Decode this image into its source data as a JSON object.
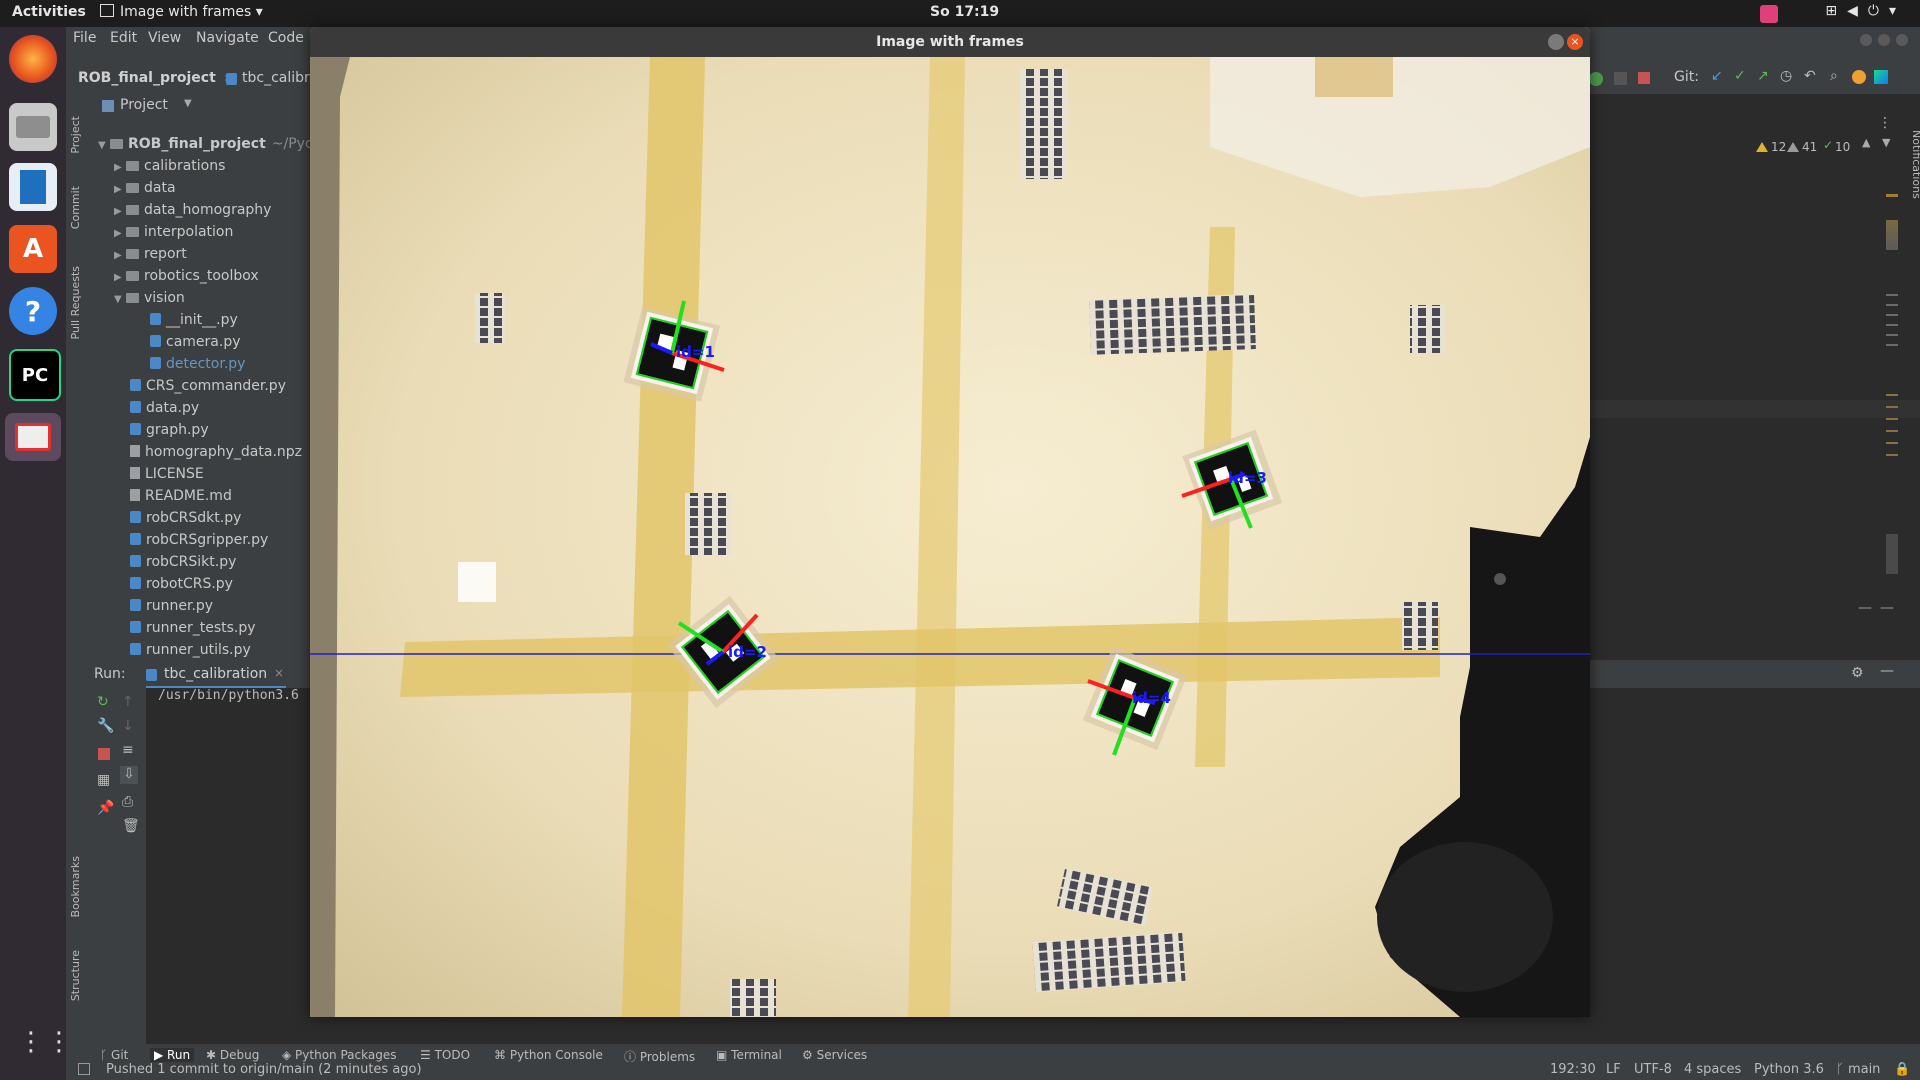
{
  "topbar": {
    "activities": "Activities",
    "window_title": "Image with frames",
    "window_menu_arrow": "▾",
    "clock": "So 17:19"
  },
  "ide": {
    "menu": [
      "File",
      "Edit",
      "View",
      "Navigate",
      "Code"
    ],
    "breadcrumb": {
      "project": "ROB_final_project",
      "file": "tbc_calibr"
    },
    "git_label": "Git:",
    "inspections": {
      "warn1": "12",
      "warn2": "41",
      "ok": "10"
    },
    "left_tabs": [
      "Project",
      "Commit",
      "Pull Requests",
      "Bookmarks",
      "Structure"
    ],
    "project_header": "Project",
    "tree": [
      {
        "label": "ROB_final_project",
        "suffix": "~/Pyc",
        "type": "root"
      },
      {
        "label": "calibrations",
        "type": "folder"
      },
      {
        "label": "data",
        "type": "folder"
      },
      {
        "label": "data_homography",
        "type": "folder"
      },
      {
        "label": "interpolation",
        "type": "folder"
      },
      {
        "label": "report",
        "type": "folder"
      },
      {
        "label": "robotics_toolbox",
        "type": "folder"
      },
      {
        "label": "vision",
        "type": "folder-open"
      },
      {
        "label": "__init__.py",
        "type": "py-nested"
      },
      {
        "label": "camera.py",
        "type": "py-nested"
      },
      {
        "label": "detector.py",
        "type": "py-nested-active"
      },
      {
        "label": "CRS_commander.py",
        "type": "py"
      },
      {
        "label": "data.py",
        "type": "py"
      },
      {
        "label": "graph.py",
        "type": "py"
      },
      {
        "label": "homography_data.npz",
        "type": "file"
      },
      {
        "label": "LICENSE",
        "type": "file"
      },
      {
        "label": "README.md",
        "type": "md"
      },
      {
        "label": "robCRSdkt.py",
        "type": "py"
      },
      {
        "label": "robCRSgripper.py",
        "type": "py"
      },
      {
        "label": "robCRSikt.py",
        "type": "py"
      },
      {
        "label": "robotCRS.py",
        "type": "py"
      },
      {
        "label": "runner.py",
        "type": "py"
      },
      {
        "label": "runner_tests.py",
        "type": "py"
      },
      {
        "label": "runner_utils.py",
        "type": "py"
      }
    ],
    "run": {
      "label": "Run:",
      "tab": "tbc_calibration",
      "output": "/usr/bin/python3.6"
    },
    "bottom_tabs": [
      "Git",
      "Run",
      "Debug",
      "Python Packages",
      "TODO",
      "Python Console",
      "Problems",
      "Terminal",
      "Services"
    ],
    "status": {
      "message": "Pushed 1 commit to origin/main (2 minutes ago)",
      "position": "192:30",
      "line_sep": "LF",
      "encoding": "UTF-8",
      "indent": "4 spaces",
      "interpreter": "Python 3.6",
      "branch": "main"
    },
    "notifications_label": "Notifications"
  },
  "image_window": {
    "title": "Image with frames",
    "markers": [
      "id=1",
      "id=3",
      "id=2",
      "id=4"
    ]
  },
  "colors": {
    "axis_x": "#ff2020",
    "axis_y": "#20e020",
    "axis_z": "#1a1aff",
    "scanline": "#2020c0"
  }
}
